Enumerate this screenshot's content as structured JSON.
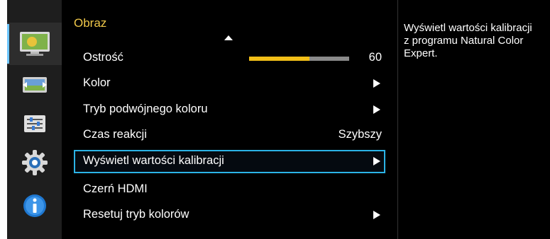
{
  "menu": {
    "title": "Obraz",
    "items": [
      {
        "label": "Ostrość",
        "value": "60",
        "slider_fraction": 0.6
      },
      {
        "label": "Kolor"
      },
      {
        "label": "Tryb podwójnego koloru"
      },
      {
        "label": "Czas reakcji",
        "value": "Szybszy"
      },
      {
        "label": "Wyświetl wartości kalibracji",
        "selected": true
      },
      {
        "label": "Czerń HDMI"
      },
      {
        "label": "Resetuj tryb kolorów"
      }
    ]
  },
  "help": {
    "text": "Wyświetl wartości kalibracji z programu Natural Color Expert."
  },
  "side_icons": [
    "picture-icon",
    "screen-size-icon",
    "settings-sliders-icon",
    "gear-icon",
    "info-icon"
  ],
  "colors": {
    "title": "#f0c84a",
    "slider_fill": "#f2bf18",
    "selection_border": "#2bb3e6"
  }
}
